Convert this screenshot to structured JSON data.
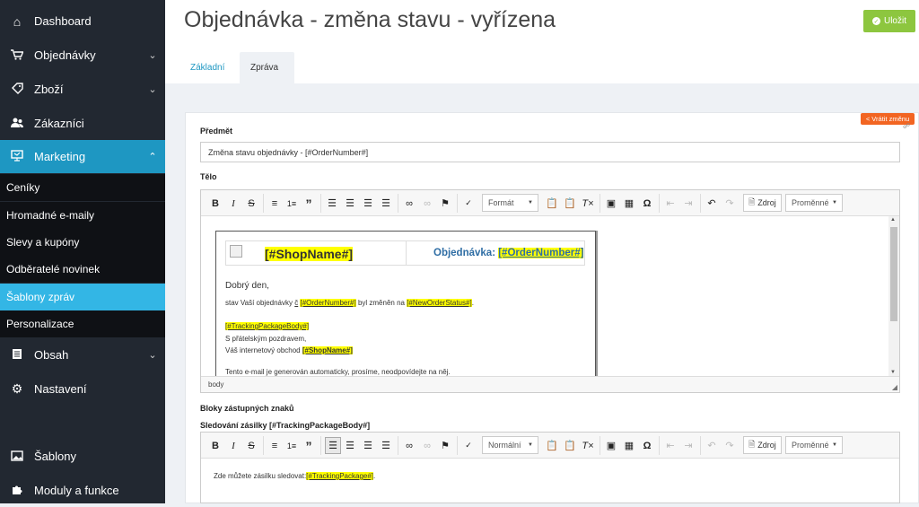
{
  "sidebar": {
    "items": [
      {
        "label": "Dashboard",
        "icon": "home-icon"
      },
      {
        "label": "Objednávky",
        "icon": "cart-icon"
      },
      {
        "label": "Zboží",
        "icon": "tag-icon"
      },
      {
        "label": "Zákazníci",
        "icon": "users-icon"
      },
      {
        "label": "Marketing",
        "icon": "presentation-icon"
      },
      {
        "label": "Obsah",
        "icon": "document-icon"
      },
      {
        "label": "Nastavení",
        "icon": "gear-icon"
      },
      {
        "label": "Šablony",
        "icon": "image-icon"
      },
      {
        "label": "Moduly a funkce",
        "icon": "puzzle-icon"
      }
    ],
    "marketing_sub": [
      "Ceníky",
      "Hromadné e-maily",
      "Slevy a kupóny",
      "Odběratelé novinek",
      "Šablony zpráv",
      "Personalizace"
    ]
  },
  "header": {
    "title": "Objednávka - změna stavu - vyřízena",
    "save_label": "Uložit"
  },
  "tabs": [
    "Základní",
    "Zpráva"
  ],
  "form": {
    "revert_label": "< Vrátit změnu",
    "subject_label": "Předmět",
    "subject_value": "Změna stavu objednávky - [#OrderNumber#]",
    "body_label": "Tělo",
    "blocks_label": "Bloky zástupných znaků",
    "tracking_label": "Sledování zásilky [#TrackingPackageBody#]"
  },
  "editor1": {
    "format_label": "Formát",
    "source_label": "Zdroj",
    "variables_label": "Proměnné",
    "status_path": "body",
    "content": {
      "shopname": "[#ShopName#]",
      "order_prefix": "Objednávka: ",
      "order_number": "[#OrderNumber#]",
      "greeting": "Dobrý den,",
      "line1_a": "stav Vaší objednávky ",
      "line1_c": "č",
      "line1_b": " byl změněn na ",
      "order_number_small": "[#OrderNumber#]",
      "new_status": "[#NewOrderStatus#]",
      "tracking_body": "[#TrackingPackageBody#]",
      "regards": "S přátelským pozdravem,",
      "shop_line": "Váš internetový obchod ",
      "shop_name_small": "[#ShopName#]",
      "auto_text": "Tento e-mail je generován automaticky, prosíme, neodpovídejte na něj."
    }
  },
  "editor2": {
    "format_label": "Normální",
    "source_label": "Zdroj",
    "variables_label": "Proměnné",
    "content_prefix": "Zde můžete zásilku sledovat:",
    "tracking_package": "[#TrackingPackage#]",
    "content_suffix": "."
  },
  "colors": {
    "sidebar_bg": "#222831",
    "active_blue": "#1e97c2",
    "selected_sub": "#33b6e5",
    "save_green": "#8dc63f",
    "revert_orange": "#f26522",
    "highlight_yellow": "#ffff00",
    "order_blue": "#2e6da4"
  }
}
